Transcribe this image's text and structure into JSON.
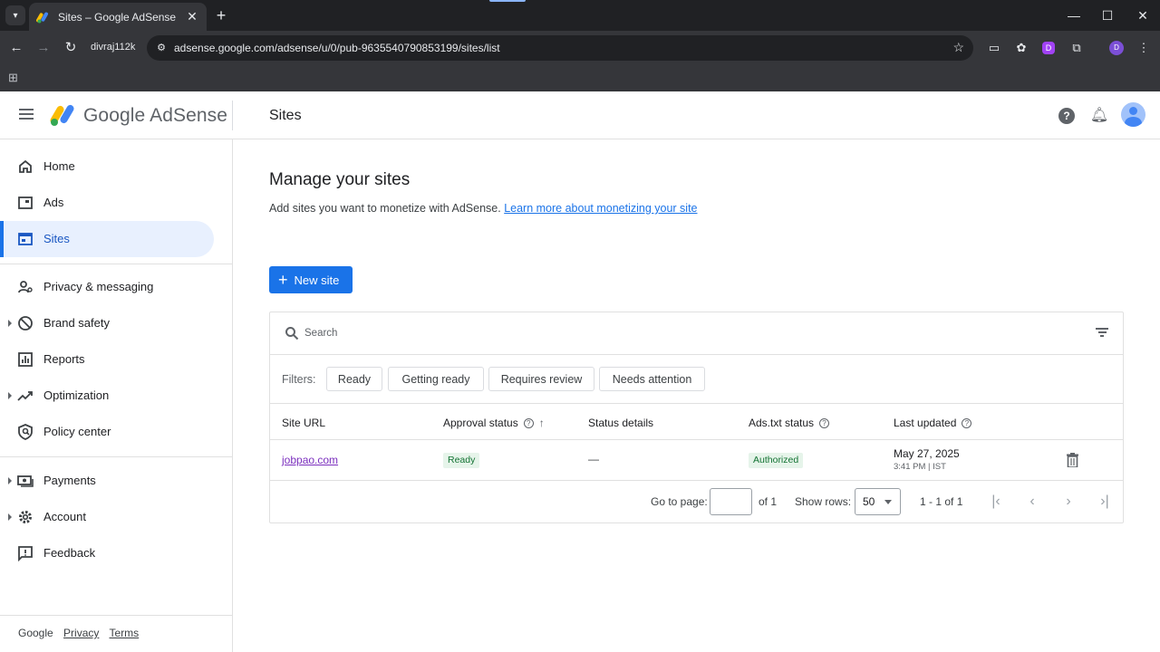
{
  "browser": {
    "tab_title": "Sites – Google AdSense",
    "profile_label": "divraj112k",
    "url": "adsense.google.com/adsense/u/0/pub-9635540790853199/sites/list",
    "avatar_letter": "D",
    "ext_letter": "D"
  },
  "header": {
    "logo_text": "Google AdSense",
    "title": "Sites"
  },
  "sidebar": {
    "items": [
      {
        "label": "Home",
        "icon": "home-icon"
      },
      {
        "label": "Ads",
        "icon": "ads-icon"
      },
      {
        "label": "Sites",
        "icon": "sites-icon",
        "active": true
      },
      {
        "label": "Privacy & messaging",
        "icon": "privacy-icon"
      },
      {
        "label": "Brand safety",
        "icon": "block-icon"
      },
      {
        "label": "Reports",
        "icon": "reports-icon"
      },
      {
        "label": "Optimization",
        "icon": "trending-icon"
      },
      {
        "label": "Policy center",
        "icon": "policy-icon"
      },
      {
        "label": "Payments",
        "icon": "payments-icon"
      },
      {
        "label": "Account",
        "icon": "gear-icon"
      },
      {
        "label": "Feedback",
        "icon": "feedback-icon"
      }
    ],
    "footer": {
      "google": "Google",
      "privacy": "Privacy",
      "terms": "Terms"
    }
  },
  "main": {
    "heading": "Manage your sites",
    "description": "Add sites you want to monetize with AdSense.",
    "learn_more": "Learn more about monetizing your site",
    "new_site_label": "New site",
    "search_placeholder": "Search",
    "filters_label": "Filters:",
    "filters": [
      "Ready",
      "Getting ready",
      "Requires review",
      "Needs attention"
    ],
    "columns": [
      "Site URL",
      "Approval status",
      "Status details",
      "Ads.txt status",
      "Last updated"
    ],
    "rows": [
      {
        "site_url": "jobpao.com",
        "approval_status": "Ready",
        "status_details": "—",
        "ads_txt_status": "Authorized",
        "last_updated_date": "May 27, 2025",
        "last_updated_time": "3:41 PM | IST"
      }
    ],
    "pagination": {
      "go_to_page_label": "Go to page:",
      "of_pages": "of 1",
      "show_rows_label": "Show rows:",
      "rows_value": "50",
      "range": "1 - 1 of 1"
    }
  },
  "colors": {
    "accent": "#1a73e8",
    "active_nav_bg": "#e8f0fe",
    "ready_badge_bg": "#e6f4ea",
    "ready_badge_text": "#137333",
    "visited_link": "#7b2fbe"
  }
}
